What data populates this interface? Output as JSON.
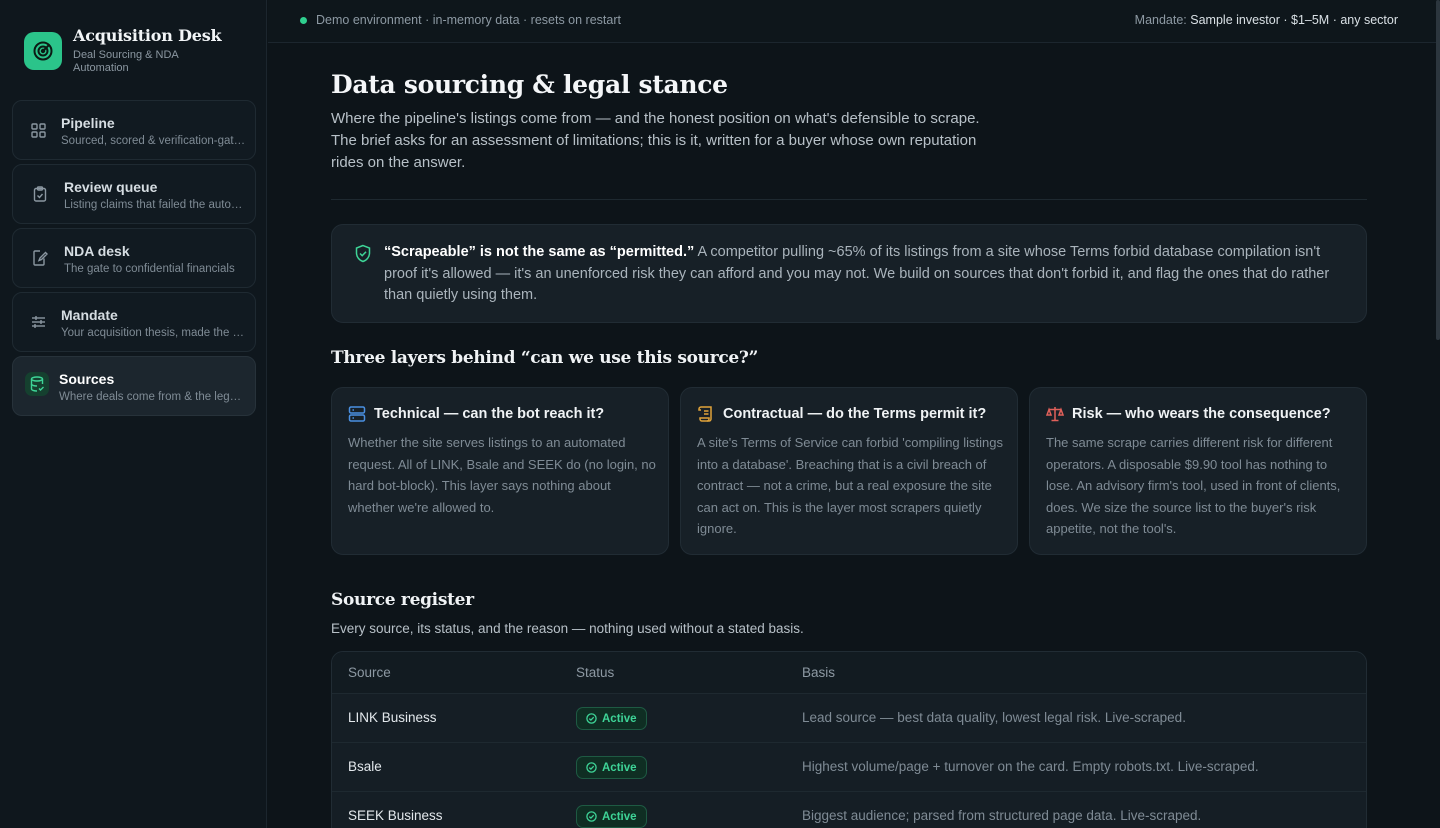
{
  "brand": {
    "title": "Acquisition Desk",
    "subtitle": "Deal Sourcing & NDA Automation",
    "logo_icon": "radar-target-icon",
    "accent": "#2bc48a"
  },
  "sidebar": {
    "items": [
      {
        "label": "Pipeline",
        "desc": "Sourced, scored & verification-gated listings",
        "icon": "grid-icon"
      },
      {
        "label": "Review queue",
        "desc": "Listing claims that failed the automated checks",
        "icon": "clipboard-check-icon"
      },
      {
        "label": "NDA desk",
        "desc": "The gate to confidential financials",
        "icon": "document-pen-icon"
      },
      {
        "label": "Mandate",
        "desc": "Your acquisition thesis, made the filter",
        "icon": "sliders-icon"
      },
      {
        "label": "Sources",
        "desc": "Where deals come from & the legal stance",
        "icon": "database-check-icon",
        "active": true
      }
    ]
  },
  "topbar": {
    "environment": "Demo environment · in-memory data · resets on restart",
    "mandate_label": "Mandate:",
    "mandate_value": "Sample investor · $1–5M · any sector"
  },
  "page": {
    "title": "Data sourcing & legal stance",
    "intro": "Where the pipeline's listings come from — and the honest position on what's defensible to scrape. The brief asks for an assessment of limitations; this is it, written for a buyer whose own reputation rides on the answer."
  },
  "callout": {
    "strong": "“Scrapeable” is not the same as “permitted.”",
    "body": " A competitor pulling ~65% of its listings from a site whose Terms forbid database compilation isn't proof it's allowed — it's an unenforced risk they can afford and you may not. We build on sources that don't forbid it, and flag the ones that do rather than quietly using them."
  },
  "layers_section": {
    "heading": "Three layers behind “can we use this source?”",
    "cards": [
      {
        "title": "Technical — can the bot reach it?",
        "icon": "server-icon",
        "icon_color": "#4a90e2",
        "body": "Whether the site serves listings to an automated request. All of LINK, Bsale and SEEK do (no login, no hard bot-block). This layer says nothing about whether we're allowed to."
      },
      {
        "title": "Contractual — do the Terms permit it?",
        "icon": "scroll-icon",
        "icon_color": "#e0a33a",
        "body": "A site's Terms of Service can forbid 'compiling listings into a database'. Breaching that is a civil breach of contract — not a crime, but a real exposure the site can act on. This is the layer most scrapers quietly ignore."
      },
      {
        "title": "Risk — who wears the consequence?",
        "icon": "scales-icon",
        "icon_color": "#e0605a",
        "body": "The same scrape carries different risk for different operators. A disposable $9.90 tool has nothing to lose. An advisory firm's tool, used in front of clients, does. We size the source list to the buyer's risk appetite, not the tool's."
      }
    ]
  },
  "register": {
    "heading": "Source register",
    "subtitle": "Every source, its status, and the reason — nothing used without a stated basis.",
    "columns": [
      "Source",
      "Status",
      "Basis"
    ],
    "rows": [
      {
        "source": "LINK Business",
        "status": "Active",
        "basis": "Lead source — best data quality, lowest legal risk. Live-scraped."
      },
      {
        "source": "Bsale",
        "status": "Active",
        "basis": "Highest volume/page + turnover on the card. Empty robots.txt. Live-scraped."
      },
      {
        "source": "SEEK Business",
        "status": "Active",
        "basis": "Biggest audience; parsed from structured page data. Live-scraped."
      }
    ],
    "status_color": "#3ed497"
  }
}
